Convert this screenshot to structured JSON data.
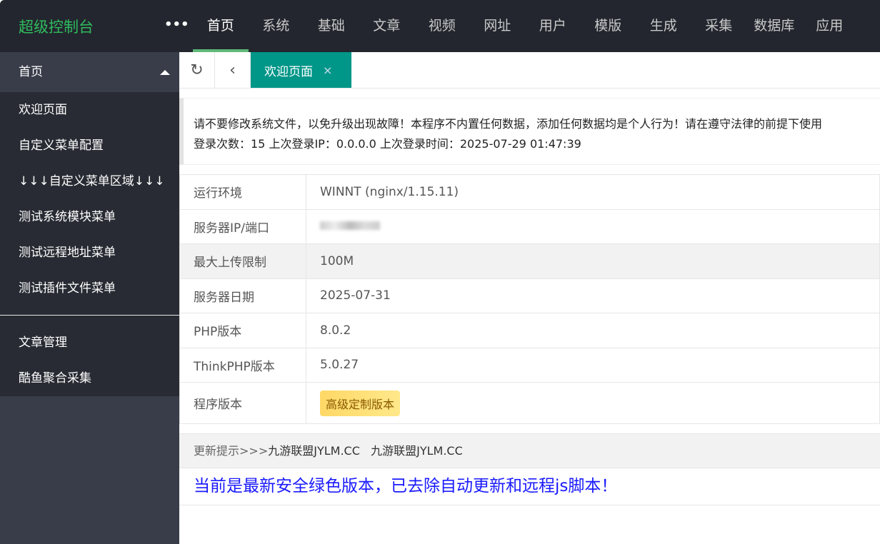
{
  "header": {
    "logo": "超级控制台",
    "more": "•••",
    "nav": [
      "首页",
      "系统",
      "基础",
      "文章",
      "视频",
      "网址",
      "用户",
      "模版",
      "生成",
      "采集",
      "数据库",
      "应用"
    ]
  },
  "sidebar": {
    "section": "首页",
    "items": [
      "欢迎页面",
      "自定义菜单配置",
      "↓↓↓自定义菜单区域↓↓↓",
      "测试系统模块菜单",
      "测试远程地址菜单",
      "测试插件文件菜单"
    ],
    "items2": [
      "文章管理",
      "酷鱼聚合采集"
    ]
  },
  "tabs": {
    "active": "欢迎页面",
    "close": "×"
  },
  "notice": {
    "line1": "请不要修改系统文件，以免升级出现故障！本程序不内置任何数据，添加任何数据均是个人行为！请在遵守法律的前提下使用",
    "line2": "登录次数：15 上次登录IP：0.0.0.0 上次登录时间：2025-07-29 01:47:39"
  },
  "info": [
    {
      "k": "运行环境",
      "v": "WINNT (nginx/1.15.11)"
    },
    {
      "k": "服务器IP/端口",
      "v": ""
    },
    {
      "k": "最大上传限制",
      "v": "100M"
    },
    {
      "k": "服务器日期",
      "v": "2025-07-31"
    },
    {
      "k": "PHP版本",
      "v": "8.0.2"
    },
    {
      "k": "ThinkPHP版本",
      "v": "5.0.27"
    },
    {
      "k": "程序版本",
      "v": "高级定制版本"
    }
  ],
  "update": {
    "prefix": "更新提示>>>",
    "text": "九游联盟JYLM.CC   九游联盟JYLM.CC"
  },
  "message": "当前是最新安全绿色版本，已去除自动更新和远程js脚本！"
}
